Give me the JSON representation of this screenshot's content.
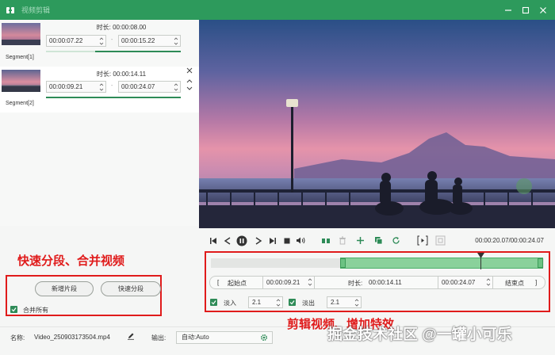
{
  "window": {
    "title": "视频剪辑",
    "colors": {
      "titlebar": "#2d9a5c",
      "accent": "#2e8b57",
      "annotation": "#e01b1b"
    }
  },
  "segments": [
    {
      "label": "Segment[1]",
      "duration_label": "时长:",
      "duration": "00:00:08.00",
      "start": "00:00:07.22",
      "end": "00:00:15.22",
      "dash": "-"
    },
    {
      "label": "Segment[2]",
      "duration_label": "时长:",
      "duration": "00:00:14.11",
      "start": "00:00:09.21",
      "end": "00:00:24.07",
      "dash": "-"
    }
  ],
  "left_panel": {
    "annotation": "快速分段、合并视频",
    "add_segment": "新增片段",
    "quick_split": "快速分段",
    "merge_all": "合并所有",
    "merge_checked": true
  },
  "player": {
    "time_display": "00:00:20.07/00:00:24.07",
    "icons": [
      "skip-start-icon",
      "step-back-icon",
      "pause-icon",
      "step-forward-icon",
      "skip-end-icon",
      "stop-icon",
      "volume-icon",
      "split-icon",
      "trash-icon",
      "plus-icon",
      "copy-icon",
      "refresh-icon",
      "bracket-icon",
      "snapshot-icon"
    ]
  },
  "trim": {
    "start_label": "起始点",
    "start_value": "00:00:09.21",
    "duration_label": "时长:",
    "duration_value": "00:00:14.11",
    "end_value": "00:00:24.07",
    "end_label": "结束点",
    "bracket_open": "[",
    "bracket_close": "]",
    "fade_in_label": "淡入",
    "fade_in_value": "2.1",
    "fade_out_label": "淡出",
    "fade_out_value": "2.1",
    "annotation": "剪辑视频、增加特效",
    "playhead_fraction": 0.833
  },
  "bottom": {
    "name_label": "名称:",
    "file_name": "Video_250903173504.mp4",
    "output_label": "输出:",
    "output_value": "自动:Auto"
  },
  "watermark": "掘金技术社区 @一罐小可乐"
}
